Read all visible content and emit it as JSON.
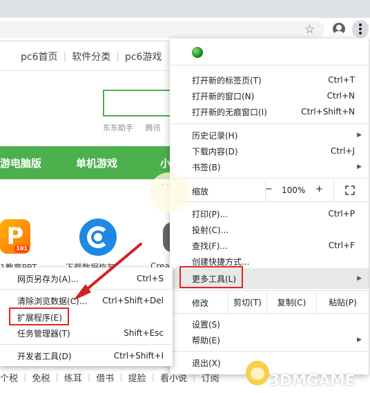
{
  "page": {
    "nav_links": [
      "pc6首页",
      "软件分类",
      "pc6游戏"
    ],
    "hot_words": [
      "东东助手",
      "腾讯"
    ],
    "green_bar": [
      "游电脑版",
      "单机游戏",
      "小"
    ],
    "app_labels": [
      "1教育PPT",
      "下载数据恢复",
      "Crea"
    ],
    "app_badge": "101",
    "tags": [
      "个税",
      "免税",
      "练耳",
      "借书",
      "提脸",
      "看小说",
      "订阅"
    ]
  },
  "menu": {
    "rows": [
      {
        "label": "打开新的标签页(T)",
        "shortcut": "Ctrl+T"
      },
      {
        "label": "打开新的窗口(N)",
        "shortcut": "Ctrl+N"
      },
      {
        "label": "打开新的无痕窗口(I)",
        "shortcut": "Ctrl+Shift+N"
      },
      {
        "label": "历史记录(H)",
        "shortcut": "▶"
      },
      {
        "label": "下载内容(D)",
        "shortcut": "Ctrl+J"
      },
      {
        "label": "书签(B)",
        "shortcut": "▶"
      },
      {
        "label": "打印(P)...",
        "shortcut": "Ctrl+P"
      },
      {
        "label": "投射(C)...",
        "shortcut": ""
      },
      {
        "label": "查找(F)...",
        "shortcut": "Ctrl+F"
      },
      {
        "label": "创建快捷方式...",
        "shortcut": ""
      },
      {
        "label": "更多工具(L)",
        "shortcut": "▶"
      },
      {
        "label": "设置(S)",
        "shortcut": ""
      },
      {
        "label": "帮助(E)",
        "shortcut": "▶"
      },
      {
        "label": "退出(X)",
        "shortcut": ""
      }
    ],
    "zoom": {
      "label": "缩放",
      "minus": "−",
      "value": "100%",
      "plus": "+"
    },
    "edit": {
      "label": "修改",
      "cut": "剪切(T)",
      "copy": "复制(C)",
      "paste": "粘贴(P)"
    }
  },
  "submenu": {
    "items": [
      {
        "label": "网页另存为(A)...",
        "shortcut": "Ctrl+S"
      },
      {
        "label": "清除浏览数据(C)...",
        "shortcut": "Ctrl+Shift+Del"
      },
      {
        "label": "扩展程序(E)",
        "shortcut": ""
      },
      {
        "label": "任务管理器(T)",
        "shortcut": "Shift+Esc"
      },
      {
        "label": "开发者工具(D)",
        "shortcut": "Ctrl+Shift+I"
      }
    ]
  },
  "watermark": "3DMGAME",
  "colors": {
    "highlight_box": "#e32222",
    "green": "#4cb04c",
    "arrow": "#d42020"
  }
}
